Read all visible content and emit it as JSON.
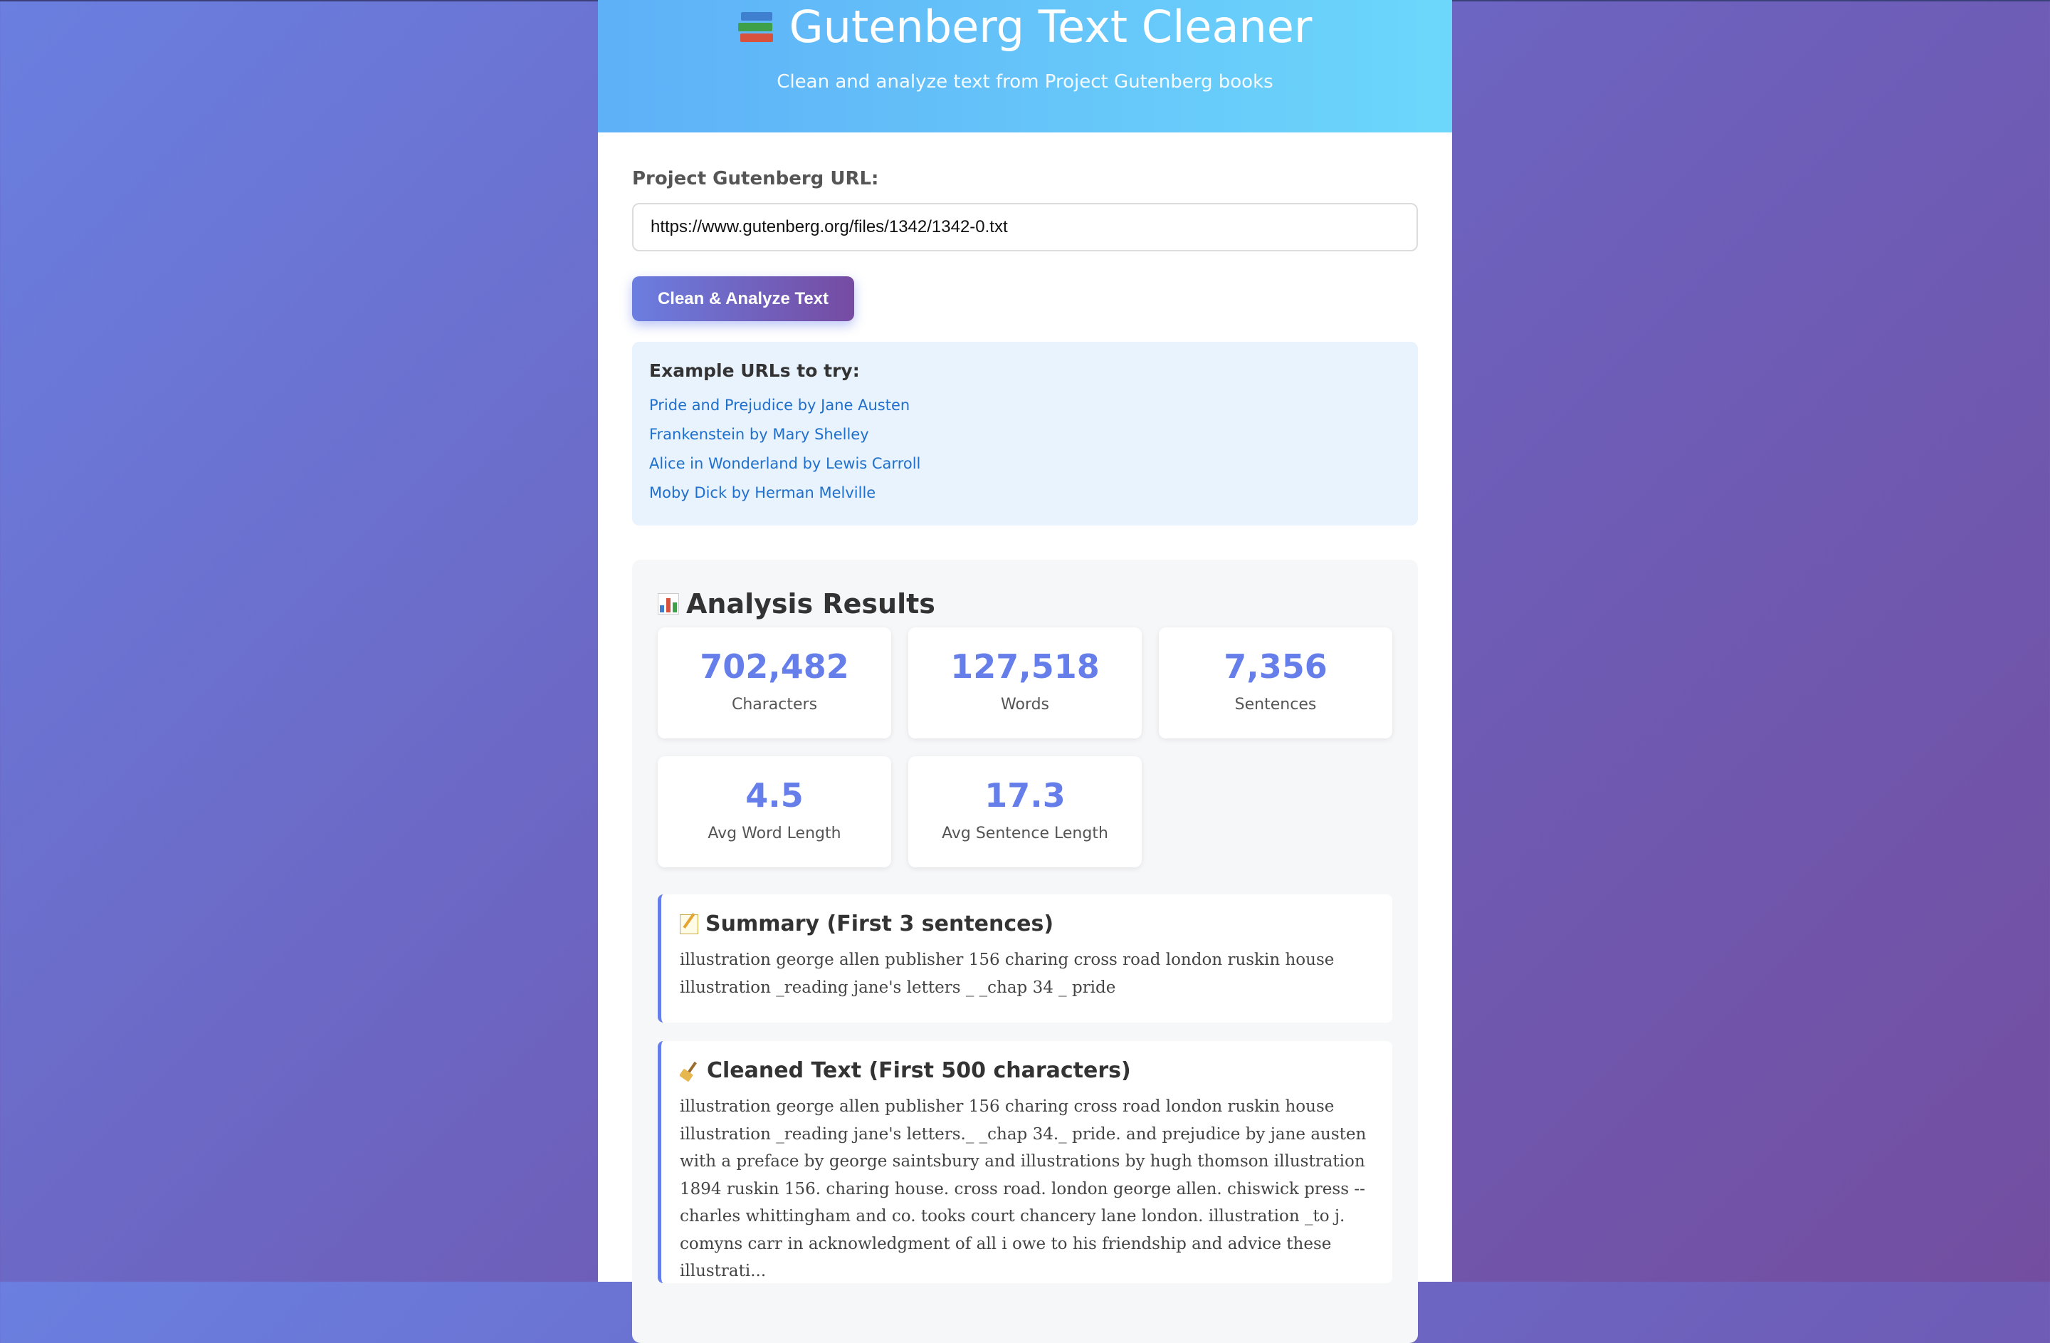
{
  "header": {
    "title": "Gutenberg Text Cleaner",
    "subtitle": "Clean and analyze text from Project Gutenberg books"
  },
  "form": {
    "url_label": "Project Gutenberg URL:",
    "url_value": "https://www.gutenberg.org/files/1342/1342-0.txt",
    "submit_label": "Clean & Analyze Text"
  },
  "examples": {
    "heading": "Example URLs to try:",
    "links": [
      "Pride and Prejudice by Jane Austen",
      "Frankenstein by Mary Shelley",
      "Alice in Wonderland by Lewis Carroll",
      "Moby Dick by Herman Melville"
    ]
  },
  "results": {
    "title": "Analysis Results",
    "stats": [
      {
        "value": "702,482",
        "label": "Characters"
      },
      {
        "value": "127,518",
        "label": "Words"
      },
      {
        "value": "7,356",
        "label": "Sentences"
      },
      {
        "value": "4.5",
        "label": "Avg Word Length"
      },
      {
        "value": "17.3",
        "label": "Avg Sentence Length"
      }
    ],
    "summary": {
      "title": "Summary (First 3 sentences)",
      "text": "illustration george allen publisher 156 charing cross road london ruskin house illustration _reading jane's letters _ _chap 34 _ pride"
    },
    "cleaned": {
      "title": "Cleaned Text (First 500 characters)",
      "text": "illustration george allen publisher 156 charing cross road london ruskin house illustration _reading jane's letters._ _chap 34._ pride. and prejudice by jane austen with a preface by george saintsbury and illustrations by hugh thomson illustration 1894 ruskin 156. charing house. cross road. london george allen. chiswick press --charles whittingham and co. tooks court chancery lane london. illustration _to j. comyns carr in acknowledgment of all i owe to his friendship and advice these illustrati..."
    }
  },
  "colors": {
    "accent": "#667eea",
    "accent_dark": "#764ba2",
    "header_start": "#5eb0f7",
    "header_end": "#6cd7fb",
    "link": "#1f6fcc",
    "examples_bg": "#e8f3fd"
  }
}
